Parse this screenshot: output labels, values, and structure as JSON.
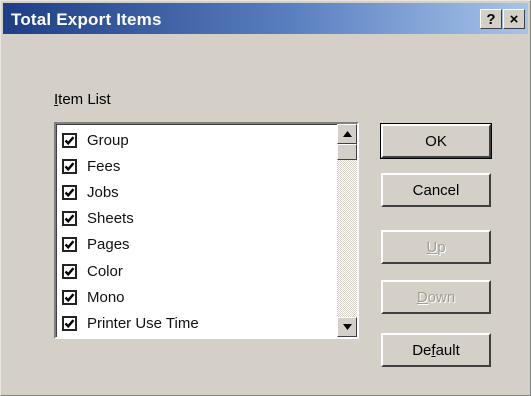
{
  "window": {
    "title": "Total Export Items",
    "help_label": "?",
    "close_label": "×"
  },
  "item_list": {
    "label_first": "I",
    "label_rest": "tem List",
    "items": [
      {
        "label": "Group",
        "checked": true
      },
      {
        "label": "Fees",
        "checked": true
      },
      {
        "label": "Jobs",
        "checked": true
      },
      {
        "label": "Sheets",
        "checked": true
      },
      {
        "label": "Pages",
        "checked": true
      },
      {
        "label": "Color",
        "checked": true
      },
      {
        "label": "Mono",
        "checked": true
      },
      {
        "label": "Printer Use Time",
        "checked": true
      }
    ]
  },
  "buttons": {
    "ok": "OK",
    "cancel": "Cancel",
    "up_first": "U",
    "up_rest": "p",
    "down_first": "D",
    "down_rest": "own",
    "default_pre": "De",
    "default_mid": "f",
    "default_post": "ault"
  },
  "colors": {
    "title_gradient_start": "#1d3e84",
    "title_gradient_end": "#a6c4ea",
    "dialog_face": "#d4d0c8",
    "disabled_text": "#a09d96"
  }
}
